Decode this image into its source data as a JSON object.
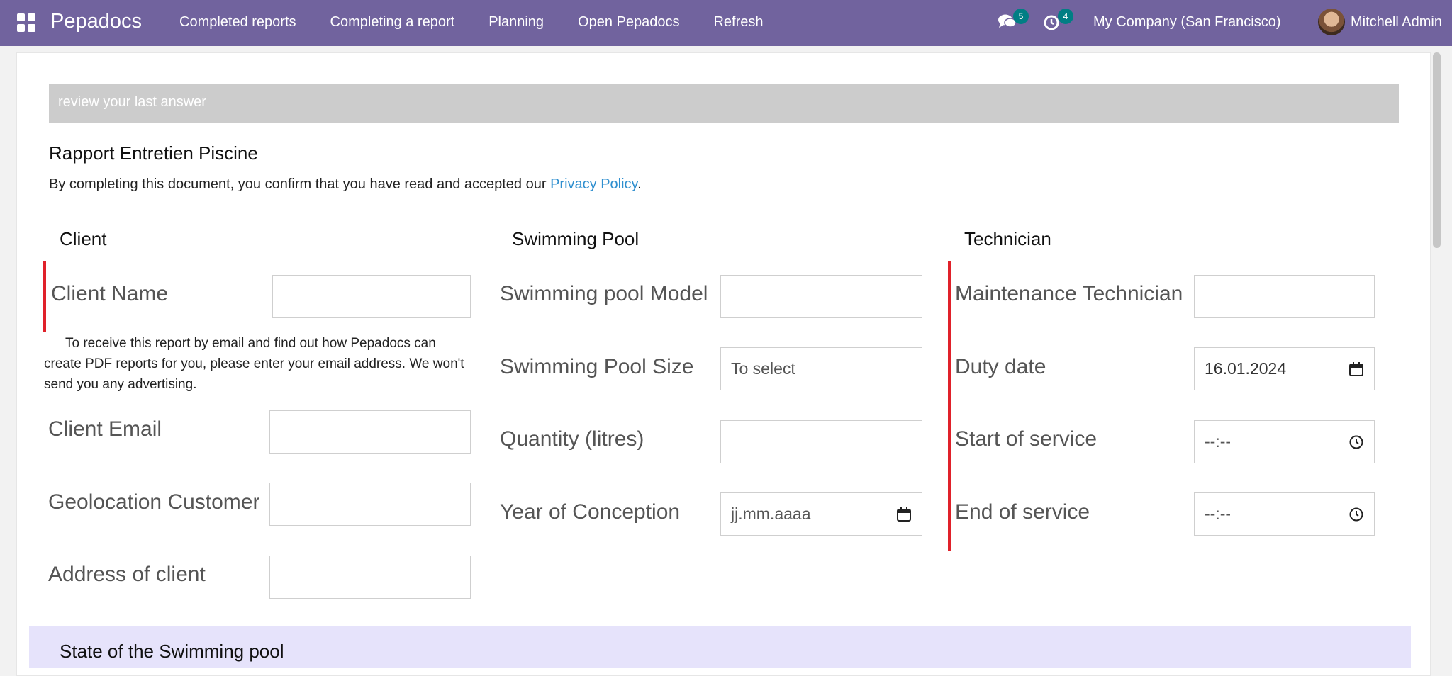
{
  "topbar": {
    "app_name": "Pepadocs",
    "menu": [
      "Completed reports",
      "Completing a report",
      "Planning",
      "Open Pepadocs",
      "Refresh"
    ],
    "messages_count": "5",
    "activities_count": "4",
    "company": "My Company (San Francisco)",
    "user": "Mitchell Admin",
    "color": "#71639e"
  },
  "banner": {
    "text": "review your last answer"
  },
  "document": {
    "title": "Rapport Entretien Piscine",
    "privacy_prefix": "By completing this document, you confirm that you have read and accepted our ",
    "privacy_link": "Privacy Policy",
    "privacy_suffix": "."
  },
  "client": {
    "title": "Client",
    "name_label": "Client Name",
    "email_note": "To receive this report by email and find out how Pepadocs can create PDF reports for you, please enter your email address. We won't send you any advertising.",
    "email_label": "Client Email",
    "geo_label": "Geolocation Customer",
    "address_label": "Address of client"
  },
  "pool": {
    "title": "Swimming Pool",
    "model_label": "Swimming pool Model",
    "size_label": "Swimming Pool Size",
    "size_value": "To select",
    "quantity_label": "Quantity (litres)",
    "year_label": "Year of Conception",
    "year_placeholder": "jj.mm.aaaa"
  },
  "technician": {
    "title": "Technician",
    "tech_label": "Maintenance Technician",
    "duty_label": "Duty date",
    "duty_value": "16.01.2024",
    "start_label": "Start of service",
    "start_value": "--:--",
    "end_label": "End of service",
    "end_value": "--:--"
  },
  "state": {
    "title": "State of the Swimming pool"
  },
  "colors": {
    "required_bar": "#e0212a",
    "link": "#2f8fcf",
    "section_band": "#e6e3fb"
  }
}
